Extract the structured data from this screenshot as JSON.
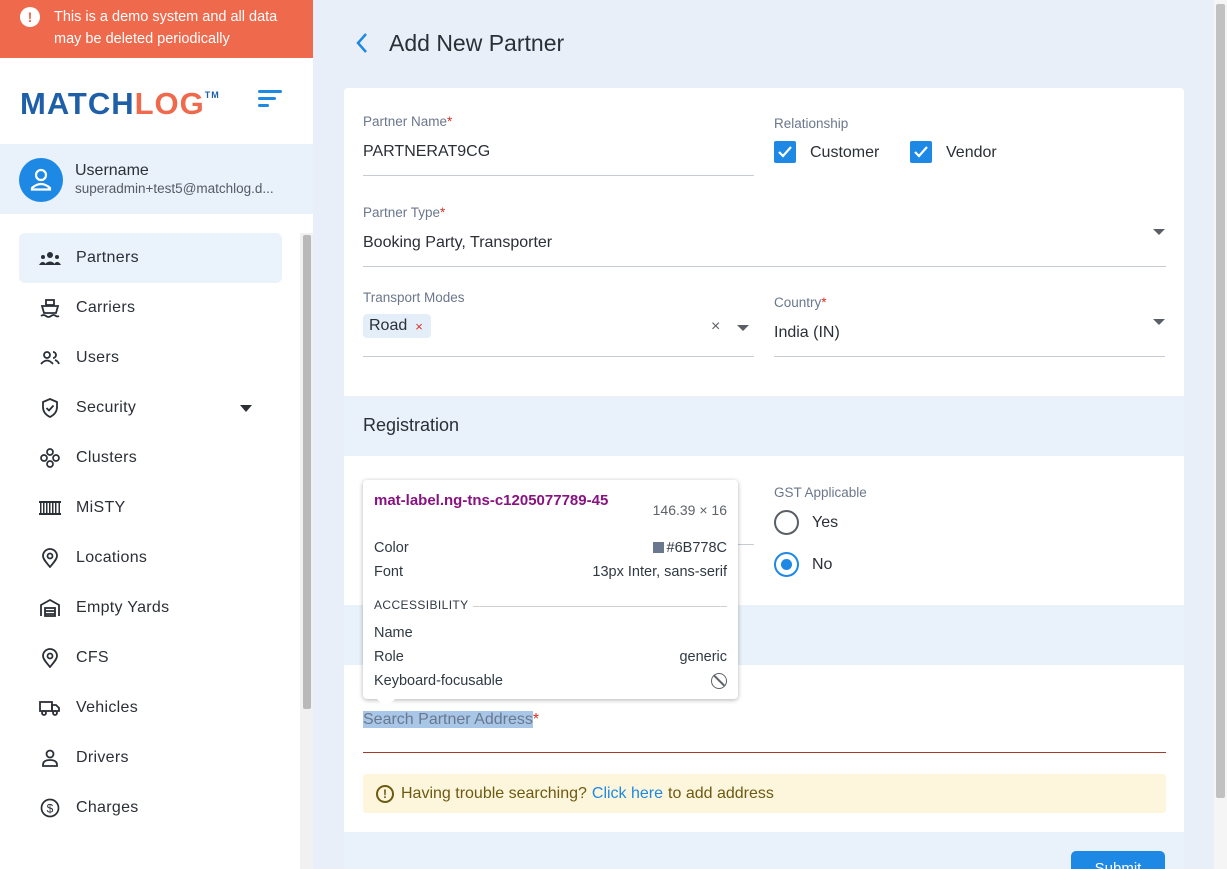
{
  "demo_banner": {
    "text": "This is a demo system and all data may be deleted periodically"
  },
  "brand": {
    "logo_part1": "MATCH",
    "logo_part2": "LOG",
    "trademark": "TM",
    "colors": {
      "blue": "#1e5fa8",
      "orange": "#ef6a4c",
      "accent": "#1e88e5"
    }
  },
  "user": {
    "name": "Username",
    "email": "superadmin+test5@matchlog.d..."
  },
  "sidebar": {
    "items": [
      {
        "label": "Partners",
        "icon": "partners-icon",
        "active": true
      },
      {
        "label": "Carriers",
        "icon": "ship-icon"
      },
      {
        "label": "Users",
        "icon": "users-icon"
      },
      {
        "label": "Security",
        "icon": "shield-icon",
        "has_caret": true
      },
      {
        "label": "Clusters",
        "icon": "clusters-icon"
      },
      {
        "label": "MiSTY",
        "icon": "barcode-icon"
      },
      {
        "label": "Locations",
        "icon": "location-pin-icon"
      },
      {
        "label": "Empty Yards",
        "icon": "warehouse-icon"
      },
      {
        "label": "CFS",
        "icon": "location-pin-icon"
      },
      {
        "label": "Vehicles",
        "icon": "truck-icon"
      },
      {
        "label": "Drivers",
        "icon": "driver-icon"
      },
      {
        "label": "Charges",
        "icon": "dollar-circle-icon"
      }
    ]
  },
  "page": {
    "title": "Add New Partner"
  },
  "form": {
    "partner_name": {
      "label": "Partner Name",
      "required": "*",
      "value": "PARTNERAT9CG"
    },
    "relationship": {
      "label": "Relationship",
      "options": [
        {
          "label": "Customer",
          "checked": true
        },
        {
          "label": "Vendor",
          "checked": true
        }
      ]
    },
    "partner_type": {
      "label": "Partner Type",
      "required": "*",
      "value": "Booking Party, Transporter"
    },
    "transport_modes": {
      "label": "Transport Modes",
      "chips": [
        "Road"
      ],
      "chip_remove": "×",
      "clear": "×"
    },
    "country": {
      "label": "Country",
      "required": "*",
      "value": "India (IN)"
    },
    "registration": {
      "title": "Registration"
    },
    "gst": {
      "label": "GST Applicable",
      "options": [
        {
          "label": "Yes",
          "selected": false
        },
        {
          "label": "No",
          "selected": true
        }
      ]
    },
    "address": {
      "label": "Search Partner Address",
      "required": "*"
    },
    "hint": {
      "icon": "!",
      "before": "Having trouble searching?",
      "link": "Click here",
      "after": "to add address"
    },
    "submit_label": "Submit"
  },
  "devtools_tooltip": {
    "selector": "mat-label.ng-tns-c1205077789-45",
    "size": "146.39 × 16",
    "color_label": "Color",
    "color_value": "#6B778C",
    "font_label": "Font",
    "font_value": "13px Inter, sans-serif",
    "section": "ACCESSIBILITY",
    "name_label": "Name",
    "name_value": "",
    "role_label": "Role",
    "role_value": "generic",
    "focus_label": "Keyboard-focusable"
  }
}
